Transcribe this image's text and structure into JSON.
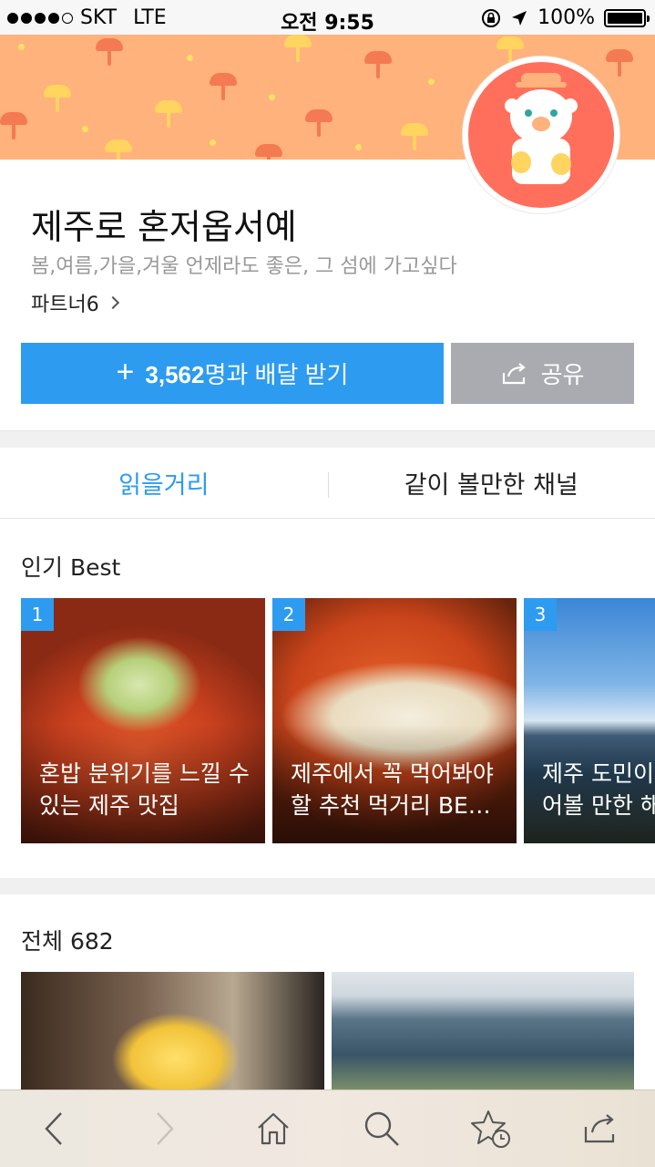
{
  "status_bar": {
    "carrier": "SKT",
    "network": "LTE",
    "time": "오전 9:55",
    "battery": "100%"
  },
  "channel": {
    "name": "제주로 혼저옵서예",
    "description": "봄,여름,가을,겨울 언제라도 좋은, 그 섬에 가고싶다",
    "partner_label": "파트너6"
  },
  "actions": {
    "subscribe_plus": "+",
    "subscribe_count": "3,562",
    "subscribe_suffix": "명과 배달 받기",
    "share_label": "공유"
  },
  "tabs": [
    {
      "label": "읽을거리",
      "active": true
    },
    {
      "label": "같이 볼만한 채널",
      "active": false
    }
  ],
  "best": {
    "title": "인기 Best",
    "cards": [
      {
        "rank": "1",
        "title": "혼밥 분위기를 느낄 수\n있는 제주 맛집"
      },
      {
        "rank": "2",
        "title": "제주에서 꼭 먹어봐야\n할 추천 먹거리 BE…"
      },
      {
        "rank": "3",
        "title": "제주 도민이\n어볼 만한 해"
      }
    ]
  },
  "all": {
    "title": "전체 682"
  },
  "toolbar": {
    "icons": [
      "back-icon",
      "forward-icon",
      "home-icon",
      "search-icon",
      "bookmark-star-icon",
      "share-icon"
    ]
  },
  "colors": {
    "accent": "#2d9bf0",
    "banner": "#ffb27b",
    "share_button": "#a9abb0",
    "avatar_bg": "#ff6f5b"
  }
}
